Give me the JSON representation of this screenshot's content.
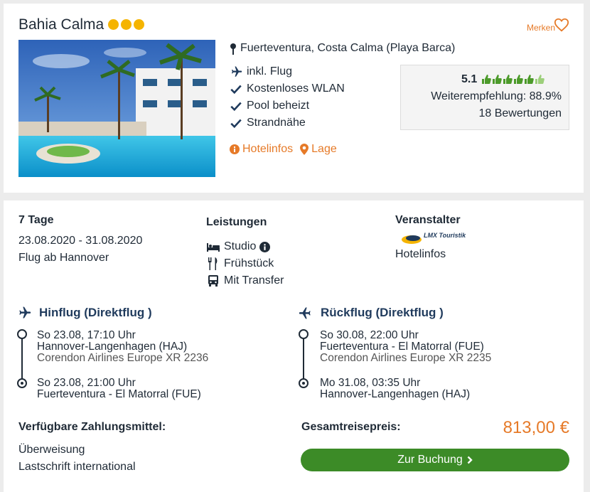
{
  "hotel": {
    "name": "Bahia Calma",
    "stars": 3,
    "save_label": "Merken",
    "location": "Fuerteventura, Costa Calma (Playa Barca)",
    "features": [
      "inkl. Flug",
      "Kostenloses WLAN",
      "Pool beheizt",
      "Strandnähe"
    ],
    "links": {
      "hotelinfos": "Hotelinfos",
      "lage": "Lage"
    },
    "rating": {
      "score": "5.1",
      "thumbs_full": 5,
      "thumbs_partial": 1,
      "recommendation": "Weiterempfehlung: 88.9%",
      "reviews": "18 Bewertungen"
    }
  },
  "offer": {
    "duration": "7 Tage",
    "dates": "23.08.2020 - 31.08.2020",
    "departure": "Flug ab Hannover",
    "services": {
      "heading": "Leistungen",
      "room": "Studio",
      "board": "Frühstück",
      "transfer": "Mit Transfer"
    },
    "operator": {
      "heading": "Veranstalter",
      "logo_text": "LMX Touristik",
      "link": "Hotelinfos"
    },
    "outbound": {
      "title": "Hinflug (Direktflug )",
      "dep_time": "So 23.08, 17:10 Uhr",
      "dep_airport": "Hannover-Langenhagen (HAJ)",
      "airline": "Corendon Airlines Europe XR 2236",
      "arr_time": "So 23.08, 21:00 Uhr",
      "arr_airport": "Fuerteventura - El Matorral (FUE)"
    },
    "return": {
      "title": "Rückflug (Direktflug )",
      "dep_time": "So 30.08, 22:00 Uhr",
      "dep_airport": "Fuerteventura - El Matorral (FUE)",
      "airline": "Corendon Airlines Europe XR 2235",
      "arr_time": "Mo 31.08, 03:35 Uhr",
      "arr_airport": "Hannover-Langenhagen (HAJ)"
    },
    "payment": {
      "heading": "Verfügbare Zahlungsmittel:",
      "methods": [
        "Überweisung",
        "Lastschrift international"
      ]
    },
    "price": {
      "label": "Gesamtreisepreis:",
      "value": "813,00 €"
    },
    "book_label": "Zur Buchung"
  },
  "colors": {
    "accent": "#e67a28",
    "button": "#3c8b27",
    "stars": "#f5b400",
    "thumbs": "#4c9a2a"
  }
}
